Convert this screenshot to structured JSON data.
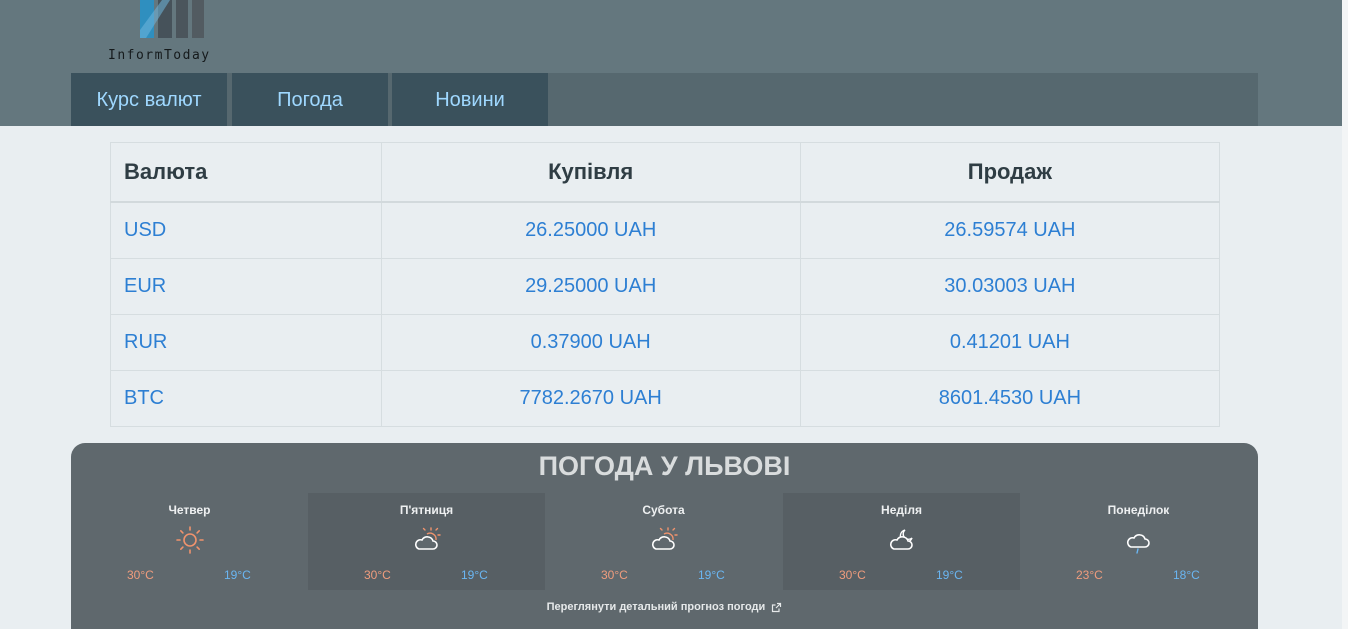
{
  "header": {
    "logo_text": "InformToday",
    "nav": [
      {
        "label": "Курс валют"
      },
      {
        "label": "Погода"
      },
      {
        "label": "Новини"
      }
    ]
  },
  "rates": {
    "headers": [
      "Валюта",
      "Купівля",
      "Продаж"
    ],
    "rows": [
      {
        "currency": "USD",
        "buy": "26.25000 UAH",
        "sell": "26.59574 UAH"
      },
      {
        "currency": "EUR",
        "buy": "29.25000 UAH",
        "sell": "30.03003 UAH"
      },
      {
        "currency": "RUR",
        "buy": "0.37900 UAH",
        "sell": "0.41201 UAH"
      },
      {
        "currency": "BTC",
        "buy": "7782.2670 UAH",
        "sell": "8601.4530 UAH"
      }
    ]
  },
  "weather": {
    "title": "ПОГОДА У ЛЬВОВІ",
    "days": [
      {
        "name": "Четвер",
        "icon": "sun-icon",
        "max": "30°C",
        "min": "19°C"
      },
      {
        "name": "П'ятниця",
        "icon": "partly-cloudy-icon",
        "max": "30°C",
        "min": "19°C"
      },
      {
        "name": "Субота",
        "icon": "partly-cloudy-icon",
        "max": "30°C",
        "min": "19°C"
      },
      {
        "name": "Неділя",
        "icon": "cloud-moon-icon",
        "max": "30°C",
        "min": "19°C"
      },
      {
        "name": "Понеділок",
        "icon": "cloud-drizzle-icon",
        "max": "23°C",
        "min": "18°C"
      }
    ],
    "link": "Переглянути детальний прогноз погоди"
  },
  "colors": {
    "header_bg": "#64777e",
    "tab_bg": "#3a515c",
    "tab_text": "#9fd8ff",
    "link_blue": "#2d7fd3",
    "weather_bg": "#5f686d",
    "temp_max": "#ef9c7d",
    "temp_min": "#6ab6f2"
  }
}
